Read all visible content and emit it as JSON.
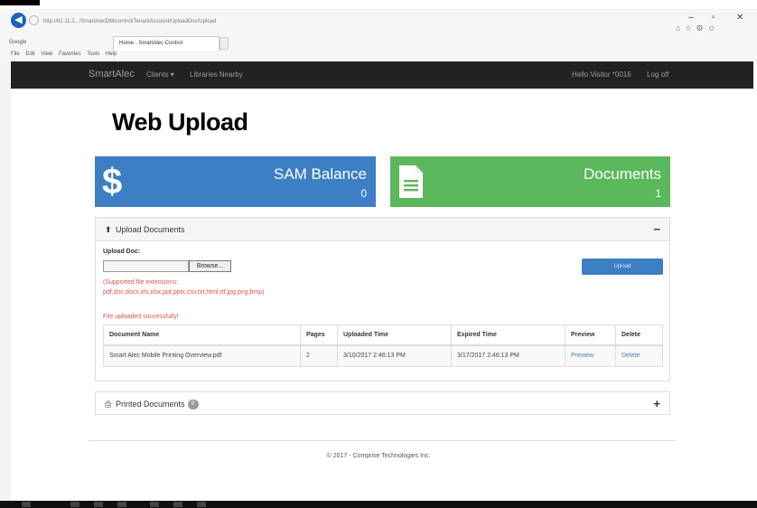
{
  "browser": {
    "url": "http://62.11.2.../SmartAlecDM/control/TenantAccount/UploadDoc/Upload",
    "tabs": [
      {
        "label": "Google"
      },
      {
        "label": "Home · SmartAlec Control"
      }
    ],
    "menu": [
      "File",
      "Edit",
      "View",
      "Favorites",
      "Tools",
      "Help"
    ],
    "window_controls": {
      "minimize": "–",
      "restore": "▫",
      "close": "✕"
    },
    "toolbar_icons": "⌂ ☆ ⚙ ☺"
  },
  "navbar": {
    "brand": "SmartAlec",
    "items": [
      {
        "label": "Clients ▾"
      },
      {
        "label": "Libraries Nearby"
      }
    ],
    "user_greeting": "Hello Visitor *0016",
    "logoff_label": "Log off"
  },
  "page": {
    "title": "Web Upload"
  },
  "tiles": {
    "balance": {
      "title": "SAM Balance",
      "value": "0",
      "icon": "dollar-icon"
    },
    "documents": {
      "title": "Documents",
      "value": "1",
      "icon": "document-icon"
    }
  },
  "upload_panel": {
    "heading": "Upload Documents",
    "toggle": "−",
    "field_label": "Upload Doc:",
    "browse_label": "Browse...",
    "upload_label": "Upload",
    "supported_line1": "(Supported file extensions:",
    "supported_line2": "pdf,doc,docx,xls,xlsx,ppt,pptx,csv,txt,html,rtf,jpg,png,bmp)",
    "success_message": "File uploaded successfully!",
    "table": {
      "headers": [
        "Document Name",
        "Pages",
        "Uploaded Time",
        "Expired Time",
        "Preview",
        "Delete"
      ],
      "rows": [
        {
          "name": "Smart Alec Mobile Printing Overview.pdf",
          "pages": "2",
          "uploaded": "3/10/2017 2:46:13 PM",
          "expired": "3/17/2017 2:46:13 PM",
          "preview": "Preview",
          "delete": "Delete"
        }
      ]
    }
  },
  "printed_panel": {
    "heading": "Printed Documents",
    "count": "0",
    "toggle": "+"
  },
  "footer": {
    "text": "© 2017 - Comprise Technologies Inc."
  }
}
